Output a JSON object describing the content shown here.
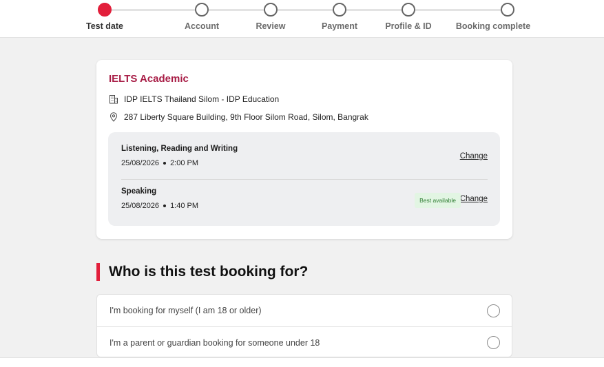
{
  "progress": {
    "steps": [
      {
        "label": "Test date",
        "active": true
      },
      {
        "label": "Account",
        "active": false
      },
      {
        "label": "Review",
        "active": false
      },
      {
        "label": "Payment",
        "active": false
      },
      {
        "label": "Profile & ID",
        "active": false
      },
      {
        "label": "Booking complete",
        "active": false
      }
    ]
  },
  "booking": {
    "title": "IELTS Academic",
    "venue": "IDP IELTS Thailand Silom - IDP Education",
    "address": "287 Liberty Square Building, 9th Floor Silom Road, Silom, Bangrak",
    "sessions": [
      {
        "title": "Listening, Reading and Writing",
        "date": "25/08/2026",
        "time": "2:00 PM",
        "change_label": "Change"
      },
      {
        "title": "Speaking",
        "date": "25/08/2026",
        "time": "1:40 PM",
        "change_label": "Change",
        "badge": "Best available"
      }
    ]
  },
  "who": {
    "heading": "Who is this test booking for?",
    "options": [
      {
        "label": "I'm booking for myself (I am 18 or older)",
        "selected": false
      },
      {
        "label": "I'm a parent or guardian booking for someone under 18",
        "selected": false
      }
    ]
  },
  "colors": {
    "accent": "#e21f3b",
    "title": "#a81d46",
    "badge_text": "#2e7d32",
    "badge_bg": "#e2f5e3"
  }
}
